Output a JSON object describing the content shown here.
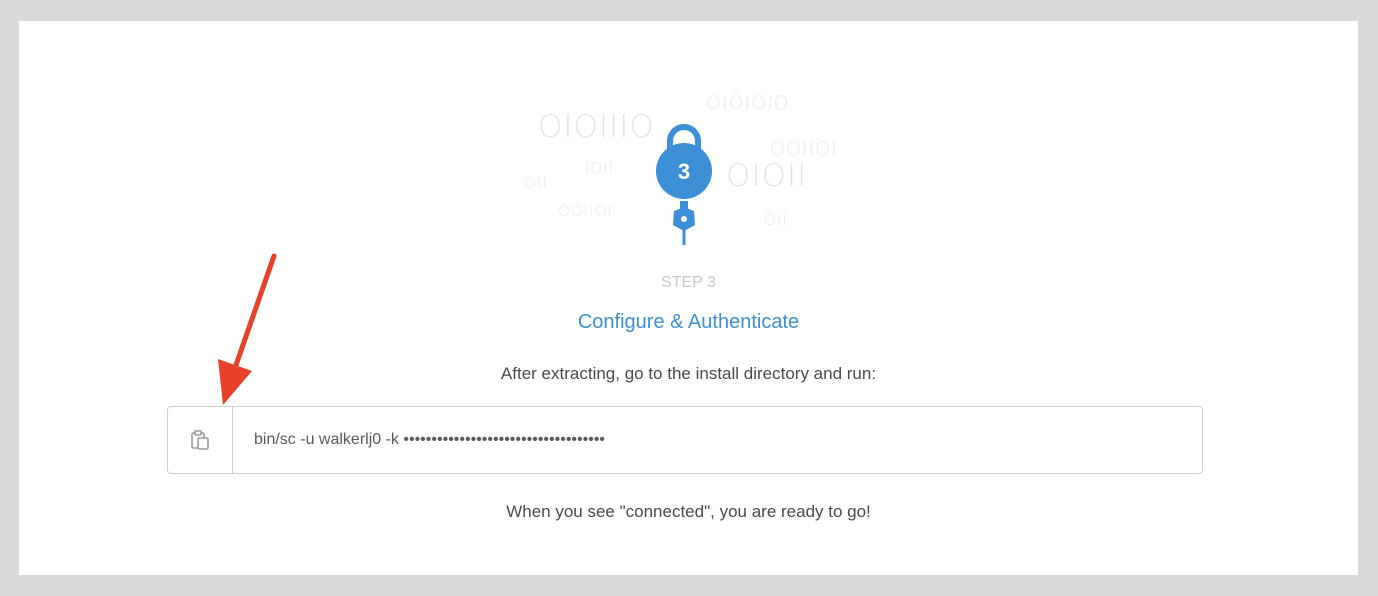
{
  "decoration": {
    "binary_strings": [
      "OIOIIIO",
      "OIOIOIO",
      "IOII",
      "OII",
      "OOIIOI",
      "OOIIOI",
      "OIOII",
      "OII"
    ]
  },
  "step": {
    "number": "3",
    "label": "STEP 3",
    "title": "Configure & Authenticate"
  },
  "instruction": "After extracting, go to the install directory and run:",
  "command": {
    "text": "bin/sc -u walkerlj0 -k ••••••••••••••••••••••••••••••••••••"
  },
  "footer": "When you see \"connected\", you are ready to go!",
  "colors": {
    "accent": "#3d8fd6",
    "annotation_arrow": "#e8402a",
    "background": "#dadada"
  },
  "icons": {
    "copy": "clipboard-icon",
    "lock": "padlock-icon",
    "key": "key-icon"
  }
}
